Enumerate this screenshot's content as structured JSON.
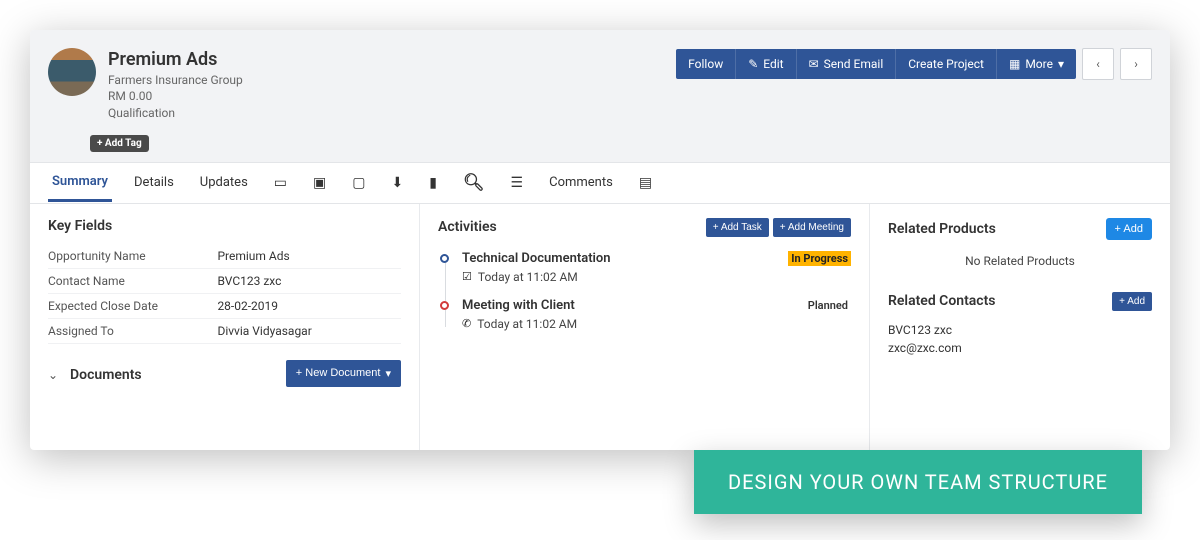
{
  "header": {
    "title": "Premium Ads",
    "company": "Farmers Insurance Group",
    "amount": "RM 0.00",
    "stage": "Qualification",
    "actions": {
      "follow": "Follow",
      "edit": "Edit",
      "send_email": "Send Email",
      "create_project": "Create Project",
      "more": "More"
    }
  },
  "addTag": "+ Add Tag",
  "tabs": {
    "summary": "Summary",
    "details": "Details",
    "updates": "Updates",
    "comments": "Comments"
  },
  "keyFields": {
    "title": "Key Fields",
    "rows": [
      {
        "k": "Opportunity Name",
        "v": "Premium Ads"
      },
      {
        "k": "Contact Name",
        "v": "BVC123 zxc"
      },
      {
        "k": "Expected Close Date",
        "v": "28-02-2019"
      },
      {
        "k": "Assigned To",
        "v": "Divvia Vidyasagar"
      }
    ]
  },
  "documents": {
    "title": "Documents",
    "newDoc": "+ New Document"
  },
  "activities": {
    "title": "Activities",
    "addTask": "+ Add Task",
    "addMeeting": "+ Add Meeting",
    "items": [
      {
        "title": "Technical Documentation",
        "status": "In Progress",
        "time": "Today at 11:02 AM",
        "icon": "check"
      },
      {
        "title": "Meeting with Client",
        "status": "Planned",
        "time": "Today at 11:02 AM",
        "icon": "phone"
      }
    ]
  },
  "relatedProducts": {
    "title": "Related Products",
    "add": "+ Add",
    "empty": "No Related Products"
  },
  "relatedContacts": {
    "title": "Related Contacts",
    "add": "+ Add",
    "name": "BVC123 zxc",
    "email": "zxc@zxc.com"
  },
  "cta": "DESIGN YOUR OWN TEAM STRUCTURE"
}
